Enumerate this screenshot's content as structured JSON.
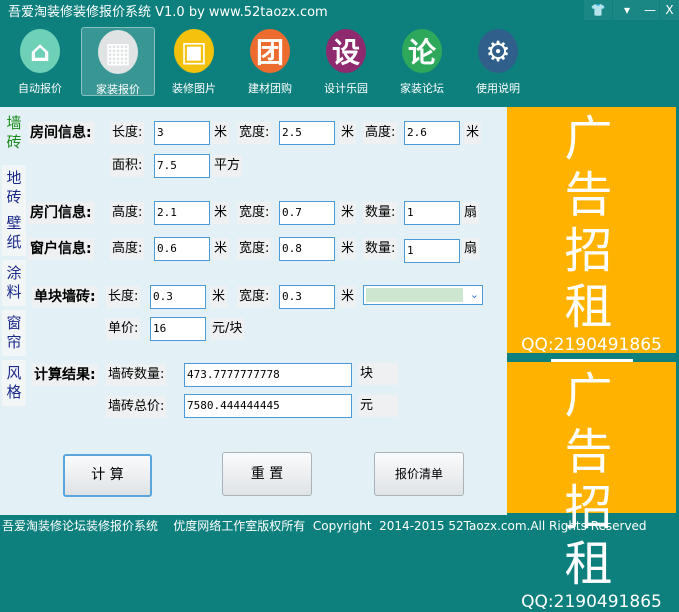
{
  "window": {
    "title": "吾爱淘装修装修报价系统 V1.0  by www.52taozx.com",
    "buttons": [
      "skin",
      "menu",
      "minimize",
      "close"
    ]
  },
  "toolbar": [
    {
      "label": "自动报价",
      "glyph": "⌂",
      "color": "#6fd0b8"
    },
    {
      "label": "家装报价",
      "glyph": "▦",
      "color": "#dfe3e4",
      "active": true
    },
    {
      "label": "装修图片",
      "glyph": "▣",
      "color": "#f4c20d"
    },
    {
      "label": "建材团购",
      "glyph": "团",
      "color": "#ec6c2f"
    },
    {
      "label": "设计乐园",
      "glyph": "设",
      "color": "#8e2a6d"
    },
    {
      "label": "家装论坛",
      "glyph": "论",
      "color": "#2ea85a"
    },
    {
      "label": "使用说明",
      "glyph": "⚙",
      "color": "#2f5f8a"
    }
  ],
  "tabs": [
    "墙砖",
    "地砖",
    "壁纸",
    "涂料",
    "窗帘",
    "风格"
  ],
  "room": {
    "label": "房间信息:",
    "length_label": "长度:",
    "length": "3",
    "width_label": "宽度:",
    "width": "2.5",
    "height_label": "高度:",
    "height": "2.6",
    "unit": "米",
    "area_label": "面积:",
    "area": "7.5",
    "area_unit": "平方"
  },
  "door": {
    "label": "房门信息:",
    "height_label": "高度:",
    "height": "2.1",
    "width_label": "宽度:",
    "width": "0.7",
    "count_label": "数量:",
    "count": "1",
    "unit": "米",
    "count_unit": "扇"
  },
  "window_info": {
    "label": "窗户信息:",
    "height_label": "高度:",
    "height": "0.6",
    "width_label": "宽度:",
    "width": "0.8",
    "count_label": "数量:",
    "count": "1",
    "unit": "米",
    "count_unit": "扇"
  },
  "tile": {
    "label": "单块墙砖:",
    "length_label": "长度:",
    "length": "0.3",
    "width_label": "宽度:",
    "width": "0.3",
    "unit": "米",
    "price_label": "单价:",
    "price": "16",
    "price_unit": "元/块"
  },
  "result": {
    "label": "计算结果:",
    "count_label": "墙砖数量:",
    "count": "473.7777777778",
    "count_unit": "块",
    "total_label": "墙砖总价:",
    "total": "7580.444444445",
    "total_unit": "元"
  },
  "buttons": {
    "calc": "计  算",
    "reset": "重  置",
    "list": "报价清单"
  },
  "ads": [
    {
      "line1": "广告",
      "line2": "招租",
      "qq": "QQ:2190491865"
    },
    {
      "line1": "广告",
      "line2": "招租",
      "qq": "QQ:2190491865"
    }
  ],
  "footer": "吾爱淘装修论坛装修报价系统    优度网络工作室版权所有  Copyright  2014-2015 52Taozx.com.All Rights Reserved"
}
